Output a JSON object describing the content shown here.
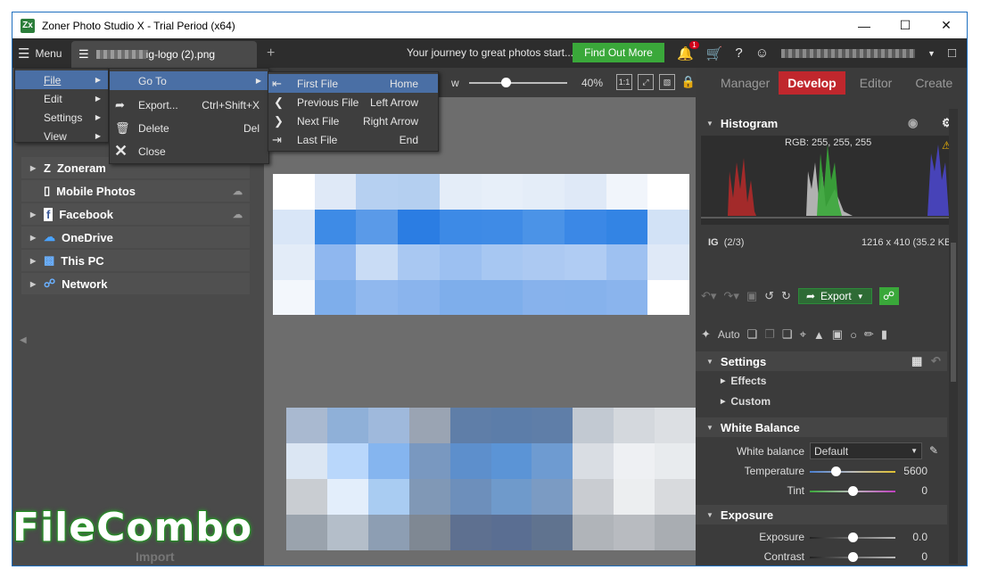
{
  "window": {
    "title": "Zoner Photo Studio X - Trial Period (x64)",
    "app_icon": "Zx"
  },
  "topbar": {
    "menu_label": "Menu",
    "doc_tab": "ig-logo (2).png",
    "promo_text": "Your journey to great photos start...",
    "find_out_label": "Find Out More",
    "notif_count": "1"
  },
  "main_menu": {
    "items": [
      "File",
      "Edit",
      "Settings",
      "View"
    ]
  },
  "file_menu": {
    "items": [
      {
        "label": "Go To",
        "shortcut": "",
        "icon": ""
      },
      {
        "label": "Export...",
        "shortcut": "Ctrl+Shift+X",
        "icon": "export-icon"
      },
      {
        "label": "Delete",
        "shortcut": "Del",
        "icon": "trash-icon"
      },
      {
        "label": "Close",
        "shortcut": "",
        "icon": "close-icon"
      }
    ]
  },
  "goto_menu": {
    "items": [
      {
        "label": "First File",
        "shortcut": "Home"
      },
      {
        "label": "Previous File",
        "shortcut": "Left Arrow"
      },
      {
        "label": "Next File",
        "shortcut": "Right Arrow"
      },
      {
        "label": "Last File",
        "shortcut": "End"
      }
    ]
  },
  "navigator": {
    "items": [
      {
        "label": "Zoneram",
        "icon": "zoner-icon"
      },
      {
        "label": "Mobile Photos",
        "icon": "phone-icon"
      },
      {
        "label": "Facebook",
        "icon": "facebook-icon"
      },
      {
        "label": "OneDrive",
        "icon": "onedrive-icon"
      },
      {
        "label": "This PC",
        "icon": "pc-icon"
      },
      {
        "label": "Network",
        "icon": "network-icon"
      }
    ],
    "import_label": "Import"
  },
  "viewer": {
    "view_label": "w",
    "zoom": "40%",
    "fit_label": "1:1"
  },
  "modes": [
    "Manager",
    "Develop",
    "Editor",
    "Create"
  ],
  "histogram": {
    "title": "Histogram",
    "rgb": "RGB: 255, 255, 255"
  },
  "file_info": {
    "name": "IG",
    "index": "(2/3)",
    "dims": "1216 x 410 (35.2 KB)"
  },
  "toolbar": {
    "export_label": "Export",
    "auto_label": "Auto"
  },
  "settings": {
    "title": "Settings",
    "effects": "Effects",
    "custom": "Custom"
  },
  "white_balance": {
    "title": "White Balance",
    "wb_label": "White balance",
    "wb_value": "Default",
    "temp_label": "Temperature",
    "temp_value": "5600",
    "tint_label": "Tint",
    "tint_value": "0"
  },
  "exposure": {
    "title": "Exposure",
    "exp_label": "Exposure",
    "exp_value": "0.0",
    "contrast_label": "Contrast",
    "contrast_value": "0"
  },
  "watermark": "FileCombo",
  "colors": {
    "accent": "#c0272d",
    "green": "#3aa83a",
    "menu_highlight": "#4a6fa5"
  }
}
